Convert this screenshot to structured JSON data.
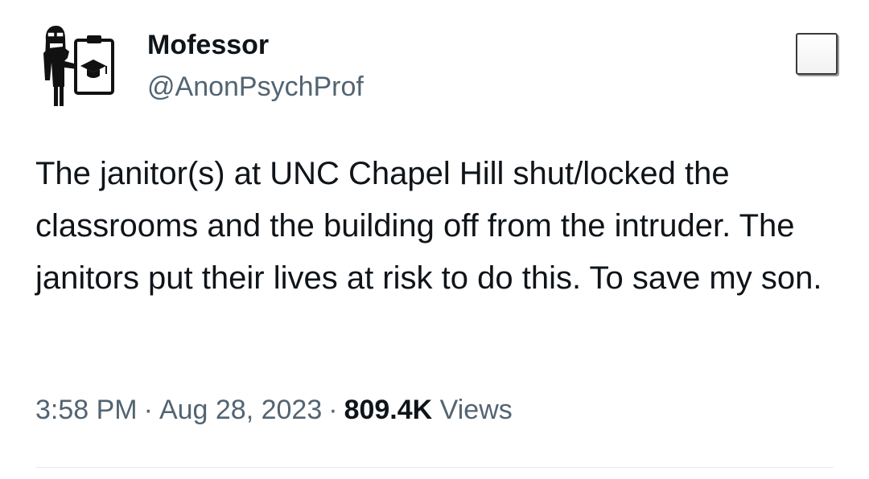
{
  "author": {
    "name": "Mofessor",
    "handle": "@AnonPsychProf",
    "avatar_icon": "professor-with-clipboard-icon"
  },
  "tweet": {
    "text": "The janitor(s) at UNC Chapel Hill shut/locked the classrooms and the building off from the intruder. The janitors put their lives at risk to do this. To save my son.",
    "time": "3:58 PM",
    "separator": "·",
    "date": "Aug 28, 2023",
    "views_count": "809.4K",
    "views_label": "Views"
  },
  "colors": {
    "primary_text": "#0f1419",
    "secondary_text": "#536471",
    "divider": "#e6ecf0"
  }
}
